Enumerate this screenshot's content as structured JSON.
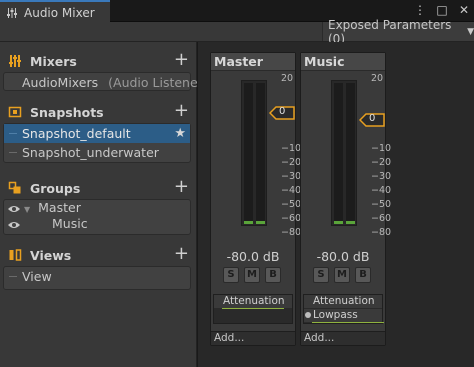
{
  "window": {
    "tab_title": "Audio Mixer",
    "icons": [
      "mixer-icon",
      "more-vert-icon",
      "maximize-icon",
      "close-icon"
    ]
  },
  "toolbar": {
    "exposed_parameters": "Exposed Parameters (0)"
  },
  "sections": {
    "mixers": {
      "title": "Mixers",
      "items": [
        {
          "name": "AudioMixers",
          "suffix": "(Audio Listener)"
        }
      ]
    },
    "snapshots": {
      "title": "Snapshots",
      "items": [
        {
          "name": "Snapshot_default",
          "selected": true,
          "starred": true
        },
        {
          "name": "Snapshot_underwater",
          "selected": false
        }
      ]
    },
    "groups": {
      "title": "Groups",
      "items": [
        {
          "name": "Master"
        },
        {
          "name": "Music"
        }
      ]
    },
    "views": {
      "title": "Views",
      "items": [
        {
          "name": "View"
        }
      ]
    }
  },
  "strips": [
    {
      "name": "Master",
      "scale": [
        "20",
        "0",
        "−10",
        "−20",
        "−30",
        "−40",
        "−50",
        "−60",
        "−80"
      ],
      "fader_value": "0",
      "level": "-80.0 dB",
      "buttons": [
        "S",
        "M",
        "B"
      ],
      "effects": [
        "Attenuation"
      ],
      "add_label": "Add..."
    },
    {
      "name": "Music",
      "scale": [
        "20",
        "0",
        "−10",
        "−20",
        "−30",
        "−40",
        "−50",
        "−60",
        "−80"
      ],
      "fader_value": "0",
      "level": "-80.0 dB",
      "buttons": [
        "S",
        "M",
        "B"
      ],
      "effects": [
        "Attenuation",
        "Lowpass"
      ],
      "add_label": "Add..."
    }
  ],
  "colors": {
    "accent": "#3a79bb",
    "selection": "#2c5d87",
    "section_icon": "#e8a020",
    "meter_green": "#5aa43a",
    "effect_underline": "#8fb23f"
  }
}
